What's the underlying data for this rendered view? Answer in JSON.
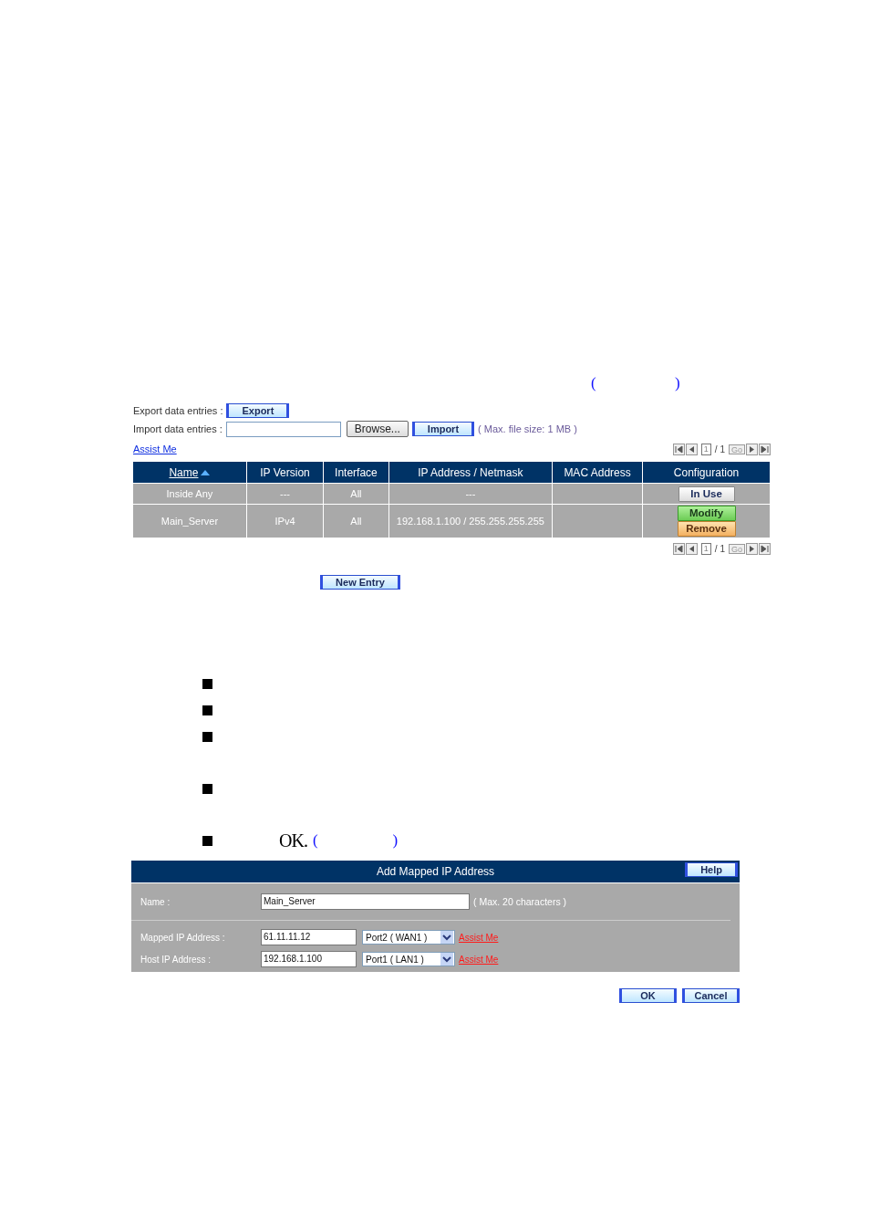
{
  "top_note": {
    "open": "(",
    "close": ")"
  },
  "export": {
    "label": "Export data entries :",
    "button": "Export"
  },
  "import": {
    "label": "Import data entries :",
    "browse": "Browse...",
    "button": "Import",
    "hint": "( Max. file size: 1 MB )"
  },
  "assist_link": "Assist Me",
  "pager_top": {
    "page": "1",
    "total": "/ 1",
    "go": "Go"
  },
  "table": {
    "columns": [
      {
        "label": "Name",
        "sorted": true
      },
      {
        "label": "IP Version",
        "sorted": false
      },
      {
        "label": "Interface",
        "sorted": false
      },
      {
        "label": "IP Address / Netmask",
        "sorted": false
      },
      {
        "label": "MAC Address",
        "sorted": false
      },
      {
        "label": "Configuration",
        "sorted": false
      }
    ],
    "rows": [
      {
        "cells": [
          "Inside Any",
          "---",
          "All",
          "---",
          ""
        ],
        "actions": [
          {
            "kind": "inuse",
            "label": "In Use"
          }
        ]
      },
      {
        "cells": [
          "Main_Server",
          "IPv4",
          "All",
          "192.168.1.100 / 255.255.255.255",
          ""
        ],
        "actions": [
          {
            "kind": "modify",
            "label": "Modify"
          },
          {
            "kind": "remove",
            "label": "Remove"
          }
        ]
      }
    ]
  },
  "pager_bottom": {
    "page": "1",
    "total": "/ 1",
    "go": "Go"
  },
  "new_entry": "New Entry",
  "bullets": [
    {
      "kind": "plain"
    },
    {
      "kind": "plain"
    },
    {
      "kind": "plain"
    },
    {
      "kind": "plain"
    },
    {
      "kind": "text",
      "text": "OK.",
      "open": "(",
      "close": ")"
    }
  ],
  "dialog": {
    "title": "Add Mapped IP Address",
    "help": "Help",
    "name": {
      "label": "Name :",
      "value": "Main_Server",
      "hint": "( Max. 20 characters )"
    },
    "fields": [
      {
        "label": "Mapped IP Address :",
        "value": "61.11.11.12",
        "select": "Port2 ( WAN1 )",
        "link": "Assist Me"
      },
      {
        "label": "Host IP Address :",
        "value": "192.168.1.100",
        "select": "Port1 ( LAN1 )",
        "link": "Assist Me"
      }
    ]
  },
  "buttons": [
    "OK",
    "Cancel"
  ]
}
